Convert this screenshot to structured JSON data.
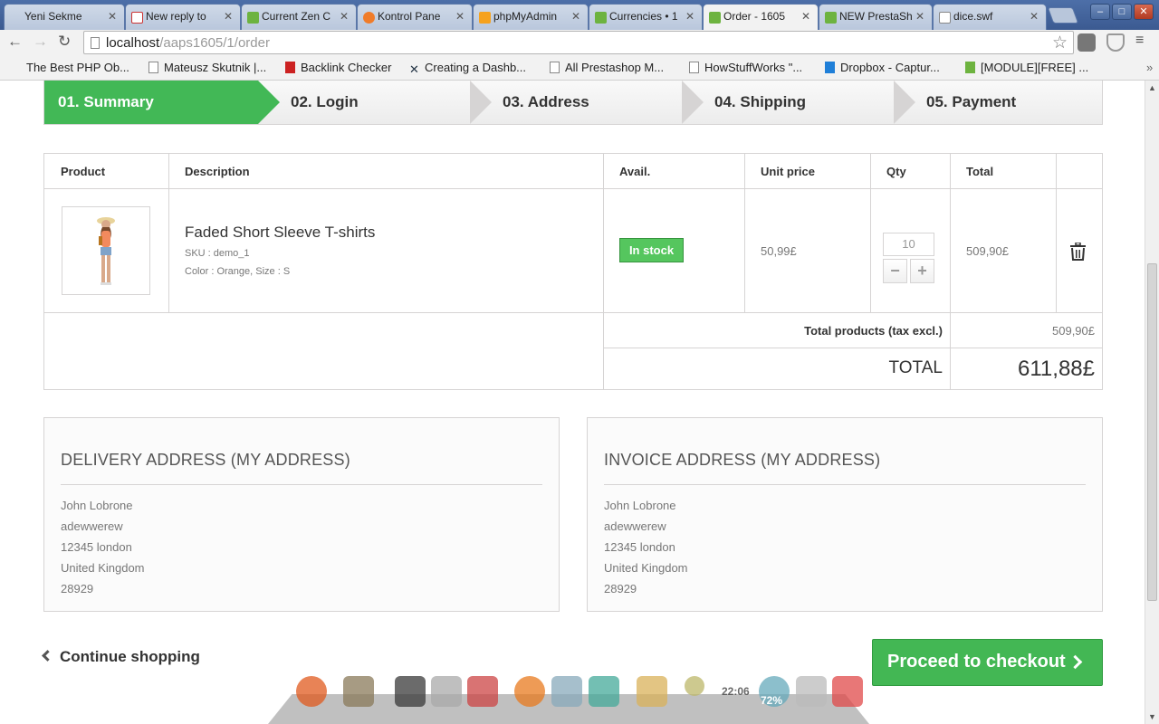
{
  "browser": {
    "tabs": [
      {
        "label": "Yeni Sekme",
        "icon": "blank-icon",
        "active": false
      },
      {
        "label": "New reply to",
        "icon": "gmail-icon",
        "active": false
      },
      {
        "label": "Current Zen C",
        "icon": "prestashop-icon",
        "active": false
      },
      {
        "label": "Kontrol Pane",
        "icon": "cpanel-icon",
        "active": false
      },
      {
        "label": "phpMyAdmin",
        "icon": "phpmyadmin-icon",
        "active": false
      },
      {
        "label": "Currencies • 1",
        "icon": "prestashop-icon",
        "active": false
      },
      {
        "label": "Order - 1605",
        "icon": "prestashop-icon",
        "active": true
      },
      {
        "label": "NEW PrestaSh",
        "icon": "prestashop-icon",
        "active": false
      },
      {
        "label": "dice.swf",
        "icon": "file-icon",
        "active": false
      }
    ],
    "url_host": "localhost",
    "url_path": "/aaps1605/1/order",
    "bookmarks": [
      {
        "label": "The Best PHP Ob...",
        "icon": "none"
      },
      {
        "label": "Mateusz Skutnik |...",
        "icon": "page-icon"
      },
      {
        "label": "Backlink Checker",
        "icon": "s-logo-icon"
      },
      {
        "label": "Creating a Dashb...",
        "icon": "tools-icon"
      },
      {
        "label": "All Prestashop M...",
        "icon": "page-icon"
      },
      {
        "label": "HowStuffWorks \"...",
        "icon": "page-icon"
      },
      {
        "label": "Dropbox - Captur...",
        "icon": "dropbox-icon"
      },
      {
        "label": "[MODULE][FREE] ...",
        "icon": "prestashop-icon"
      }
    ]
  },
  "steps": [
    {
      "label": "01. Summary",
      "active": true
    },
    {
      "label": "02. Login",
      "active": false
    },
    {
      "label": "03. Address",
      "active": false
    },
    {
      "label": "04. Shipping",
      "active": false
    },
    {
      "label": "05. Payment",
      "active": false
    }
  ],
  "cart": {
    "headers": {
      "product": "Product",
      "description": "Description",
      "avail": "Avail.",
      "unit_price": "Unit price",
      "qty": "Qty",
      "total": "Total"
    },
    "item": {
      "name": "Faded Short Sleeve T-shirts",
      "sku": "SKU : demo_1",
      "attributes": "Color : Orange, Size : S",
      "availability": "In stock",
      "unit_price": "50,99£",
      "quantity": "10",
      "total": "509,90£"
    },
    "summary": {
      "total_products_label": "Total products (tax excl.)",
      "total_products_value": "509,90£",
      "total_label": "TOTAL",
      "total_value": "611,88£"
    }
  },
  "delivery_address": {
    "title": "DELIVERY ADDRESS (MY ADDRESS)",
    "lines": [
      "John Lobrone",
      "adewwerew",
      "12345 london",
      "United Kingdom",
      "28929"
    ]
  },
  "invoice_address": {
    "title": "INVOICE ADDRESS (MY ADDRESS)",
    "lines": [
      "John Lobrone",
      "adewwerew",
      "12345 london",
      "United Kingdom",
      "28929"
    ]
  },
  "actions": {
    "continue_label": "Continue shopping",
    "checkout_label": "Proceed to checkout"
  },
  "dock": {
    "clock": "22:06",
    "battery": "72%"
  },
  "colors": {
    "accent_green": "#42b856",
    "stock_green": "#55c65e"
  }
}
